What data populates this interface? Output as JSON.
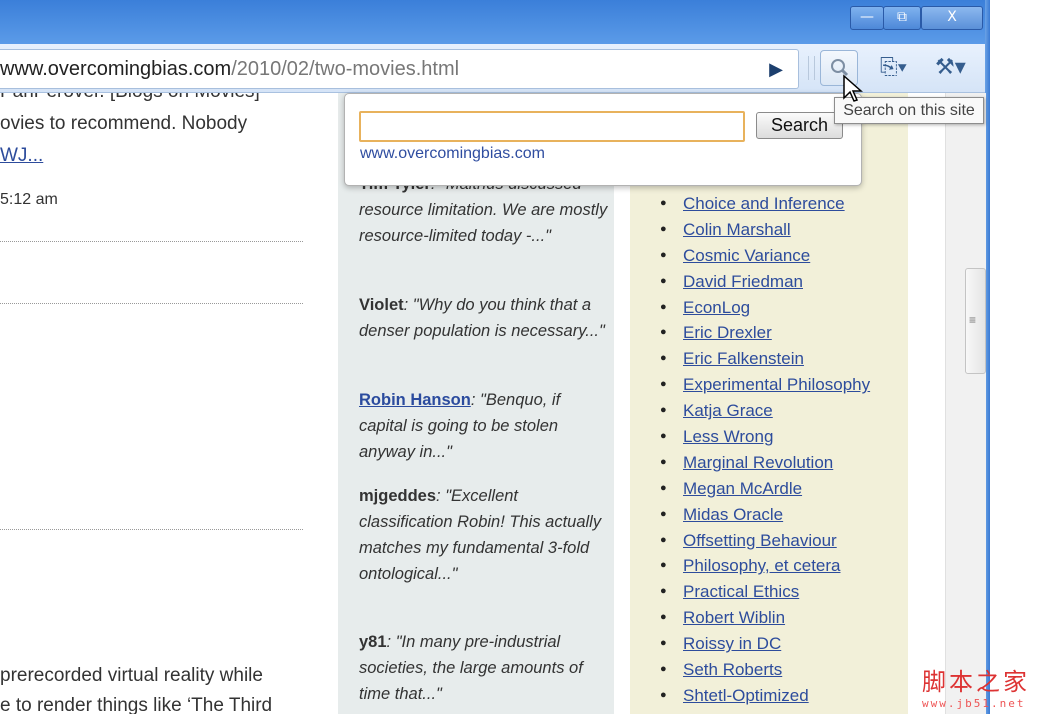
{
  "window": {
    "minimize_label": "—",
    "maximize_label": "⧉",
    "close_label": "X"
  },
  "toolbar": {
    "url_host": "www.overcomingbias.com",
    "url_path": "/2010/02/two-movies.html",
    "go_icon": "▶",
    "page_menu_icon": "⎘▾",
    "wrench_icon": "⚒▾"
  },
  "left_column": {
    "line1": "PanPerover. [Blogs on Movies]",
    "line2": "ovies to recommend. Nobody",
    "link": "WJ...",
    "timestamp": "5:12 am",
    "line3": " prerecorded virtual reality while",
    "line4": "e to render things like ‘The Third"
  },
  "comments": [
    {
      "author": "Tim Tyler",
      "text": ": \"Malthus discussed resource limitation. We are mostly resource-limited today -...\""
    },
    {
      "author": "Violet",
      "text": ": \"Why do you think that a denser population is necessary...\""
    },
    {
      "author": "Robin Hanson",
      "text": ": \"Benquo, if capital is going to be stolen anyway in...\""
    },
    {
      "author": "mjgeddes",
      "text": ": \"Excellent classification Robin! This actually matches my fundamental 3-fold ontological...\""
    },
    {
      "author": "y81",
      "text": ": \"In many pre-industrial societies, the large amounts of time that...\""
    }
  ],
  "blogroll": [
    "Choice and Inference",
    "Colin Marshall",
    "Cosmic Variance",
    "David Friedman",
    "EconLog",
    "Eric Drexler",
    "Eric Falkenstein",
    "Experimental Philosophy",
    "Katja Grace",
    "Less Wrong",
    "Marginal Revolution",
    "Megan McArdle",
    "Midas Oracle",
    "Offsetting Behaviour",
    "Philosophy, et cetera",
    "Practical Ethics",
    "Robert Wiblin",
    "Roissy in DC",
    "Seth Roberts",
    "Shtetl-Optimized"
  ],
  "search_popup": {
    "input_value": "",
    "button_label": "Search",
    "site": "www.overcomingbias.com"
  },
  "tooltip": "Search on this site",
  "scrollbar_grip": "≡",
  "watermark": {
    "text": "脚本之家",
    "url": "www.jb51.net"
  }
}
